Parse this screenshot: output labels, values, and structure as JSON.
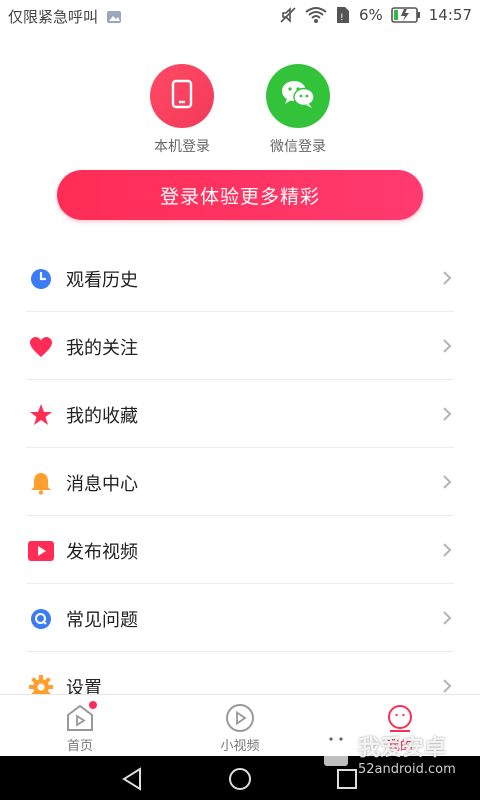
{
  "status_bar": {
    "carrier_text": "仅限紧急呼叫",
    "battery_percent": "6%",
    "time": "14:57"
  },
  "login": {
    "methods": [
      {
        "label": "本机登录",
        "icon": "phone-icon",
        "color": "#ff4a64"
      },
      {
        "label": "微信登录",
        "icon": "wechat-icon",
        "color": "#33c33a"
      }
    ],
    "cta": "登录体验更多精彩"
  },
  "menu": {
    "items": [
      {
        "label": "观看历史",
        "icon": "clock-icon",
        "color": "#3b7cf5"
      },
      {
        "label": "我的关注",
        "icon": "heart-icon",
        "color": "#ff2d55"
      },
      {
        "label": "我的收藏",
        "icon": "star-icon",
        "color": "#ff2d55"
      },
      {
        "label": "消息中心",
        "icon": "bell-icon",
        "color": "#ff9f2e"
      },
      {
        "label": "发布视频",
        "icon": "video-play-icon",
        "color": "#ff2d55"
      },
      {
        "label": "常见问题",
        "icon": "question-icon",
        "color": "#3b7cf5"
      },
      {
        "label": "设置",
        "icon": "gear-icon",
        "color": "#ff9f2e"
      }
    ]
  },
  "bottom_nav": {
    "items": [
      {
        "label": "首页",
        "icon": "home-play-icon"
      },
      {
        "label": "小视频",
        "icon": "play-circle-icon"
      },
      {
        "label": "我的",
        "icon": "smile-icon",
        "active": true
      }
    ]
  },
  "watermark": {
    "title": "我爱安卓",
    "url": "52android.com"
  },
  "colors": {
    "accent": "#ff2d55",
    "wechat": "#33c33a",
    "text": "#222222",
    "muted": "#666666"
  }
}
